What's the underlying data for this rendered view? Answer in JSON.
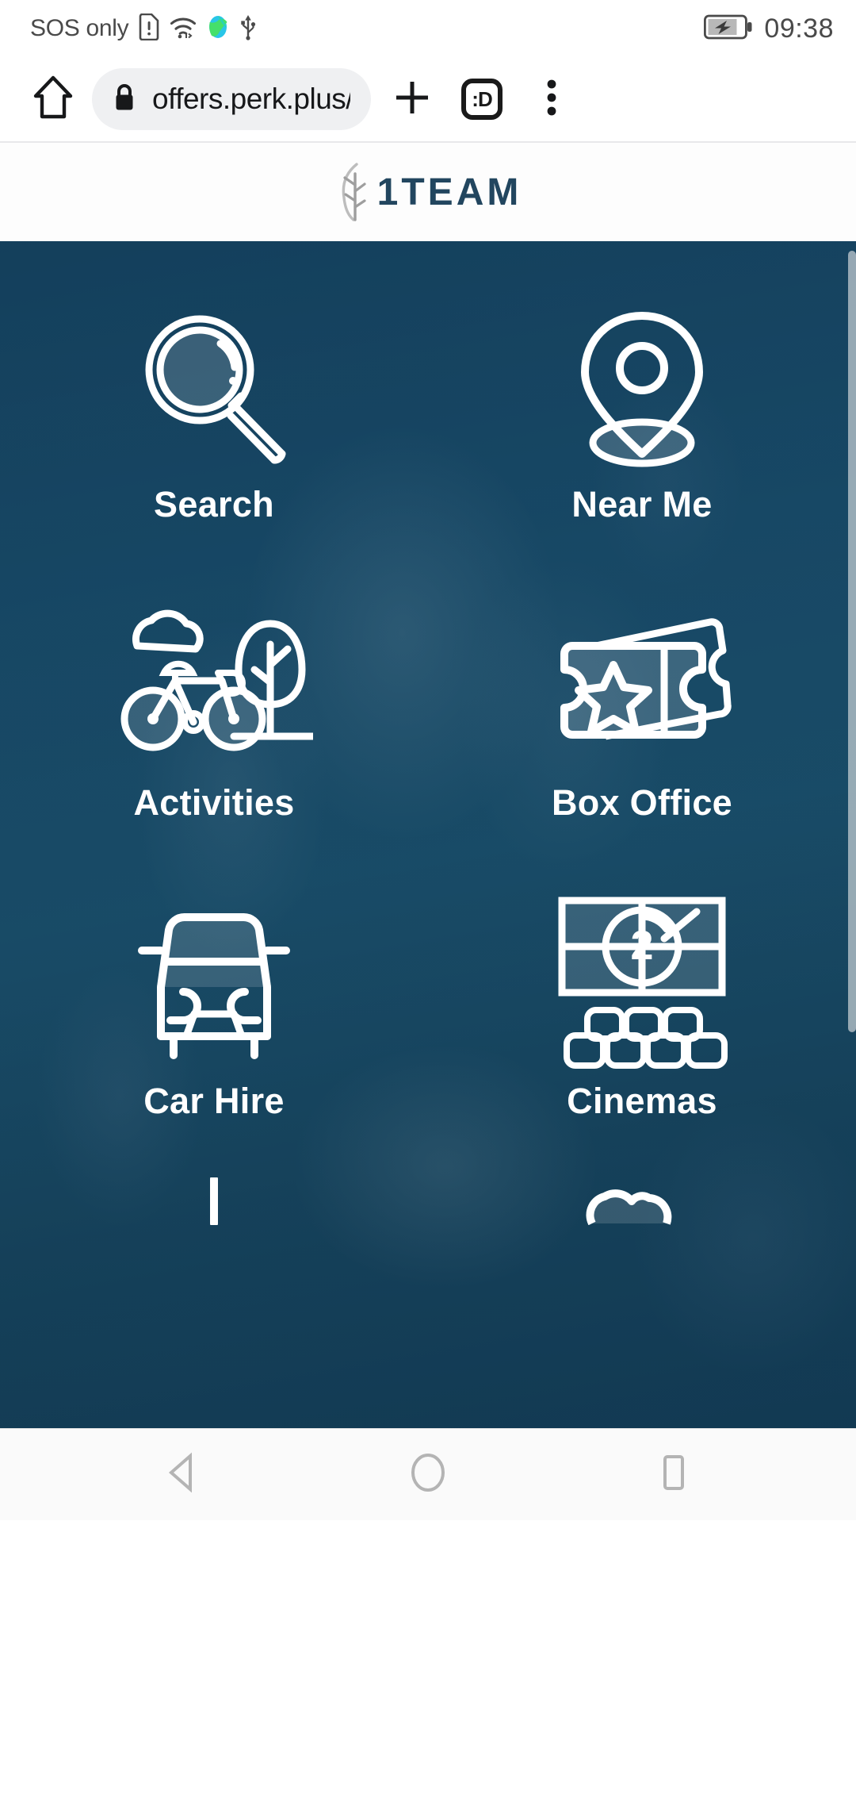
{
  "status_bar": {
    "carrier_text": "SOS only",
    "icons": [
      "sim-alert-icon",
      "wifi-icon",
      "location-globe-icon",
      "usb-icon"
    ],
    "battery": "battery-charging-icon",
    "time": "09:38"
  },
  "browser": {
    "home_icon": "home-icon",
    "lock_icon": "lock-icon",
    "url": "offers.perk.plus/?",
    "new_tab_icon": "plus-icon",
    "tab_count_label": ":D",
    "menu_icon": "more-vertical-icon"
  },
  "site_header": {
    "logo_mark": "tree-branch-icon",
    "logo_text": "1TEAM",
    "logo_color": "#22465f"
  },
  "page": {
    "background_color": "#174a66",
    "accent_color": "#ffffff",
    "tiles": [
      {
        "label": "Search",
        "icon": "magnifier-icon"
      },
      {
        "label": "Near Me",
        "icon": "map-pin-icon"
      },
      {
        "label": "Activities",
        "icon": "bicycle-tree-icon"
      },
      {
        "label": "Box Office",
        "icon": "ticket-star-icon"
      },
      {
        "label": "Car Hire",
        "icon": "car-front-icon"
      },
      {
        "label": "Cinemas",
        "icon": "cinema-screen-seats-icon"
      }
    ],
    "partial_tiles": [
      {
        "icon": "partial-icon-left"
      },
      {
        "icon": "partial-cloud-icon"
      }
    ]
  },
  "nav_bar": {
    "back_label": "back-icon",
    "home_label": "home-circle-icon",
    "recents_label": "recents-square-icon"
  }
}
